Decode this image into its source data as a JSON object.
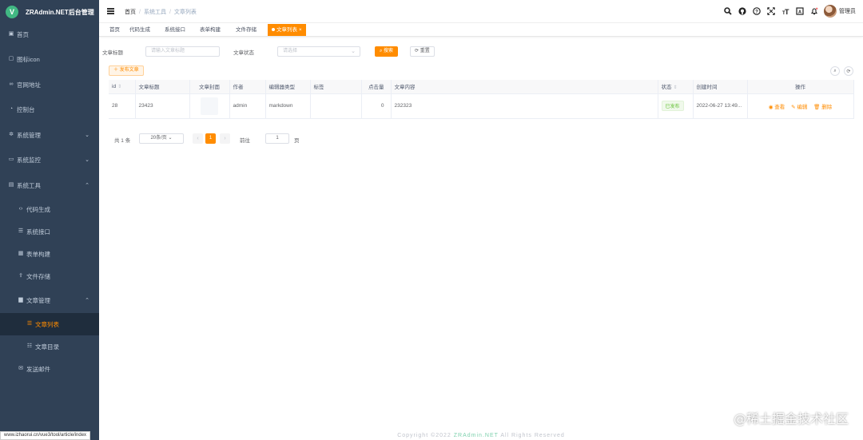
{
  "app": {
    "title": "ZRAdmin.NET后台管理",
    "logo_letter": "V"
  },
  "sidebar": {
    "items": [
      {
        "label": "首页",
        "icon": "dashboard-icon"
      },
      {
        "label": "图标icon",
        "icon": "image-icon"
      },
      {
        "label": "官网地址",
        "icon": "link-icon"
      },
      {
        "label": "控制台",
        "icon": "gauge-icon"
      },
      {
        "label": "系统管理",
        "icon": "gear-icon"
      },
      {
        "label": "系统监控",
        "icon": "monitor-icon"
      },
      {
        "label": "系统工具",
        "icon": "toolbox-icon"
      },
      {
        "label": "代码生成",
        "icon": "code-icon"
      },
      {
        "label": "系统接口",
        "icon": "list-icon"
      },
      {
        "label": "表单构建",
        "icon": "form-icon"
      },
      {
        "label": "文件存储",
        "icon": "upload-icon"
      },
      {
        "label": "文章管理",
        "icon": "document-icon"
      },
      {
        "label": "文章列表",
        "icon": "list-icon"
      },
      {
        "label": "文章目录",
        "icon": "tree-icon"
      },
      {
        "label": "发送邮件",
        "icon": "mail-icon"
      }
    ]
  },
  "breadcrumb": [
    "首页",
    "系统工具",
    "文章列表"
  ],
  "header": {
    "user_name": "管理员"
  },
  "tags": [
    "首页",
    "代码生成",
    "系统接口",
    "表单构建",
    "文件存储",
    "文章列表"
  ],
  "search": {
    "title_label": "文章标题",
    "title_placeholder": "请输入文章标题",
    "status_label": "文章状态",
    "status_placeholder": "请选择",
    "search_button": "搜索",
    "reset_button": "重置"
  },
  "toolbar": {
    "publish_button": "发布文章"
  },
  "table": {
    "columns": [
      "id",
      "文章标题",
      "文章封面",
      "作者",
      "编辑器类型",
      "标签",
      "点击量",
      "文章内容",
      "状态",
      "创建时间",
      "操作"
    ],
    "rows": [
      {
        "id": "28",
        "title": "23423",
        "author": "admin",
        "editor": "markdown",
        "tags": "",
        "clicks": "0",
        "content": "232323",
        "status": "已发布",
        "created": "2022-06-27 13:49...",
        "actions": [
          "查看",
          "编辑",
          "删除"
        ]
      }
    ]
  },
  "pagination": {
    "total_text": "共 1 条",
    "page_size": "20条/页",
    "current_page": "1",
    "goto_label": "前往",
    "goto_value": "1",
    "page_suffix": "页"
  },
  "footer": {
    "prefix": "Copyright ©2022 ",
    "brand": "ZRAdmin.NET",
    "suffix": " All Rights Reserved"
  },
  "status_url": "www.izhaorui.cn/vue3/tool/article/index",
  "watermark": "@稀土掘金技术社区",
  "colors": {
    "accent": "#ff8c00",
    "sidebar_bg": "#304156",
    "active_sub_bg": "#1f2d3d",
    "success": "#67c23a"
  }
}
